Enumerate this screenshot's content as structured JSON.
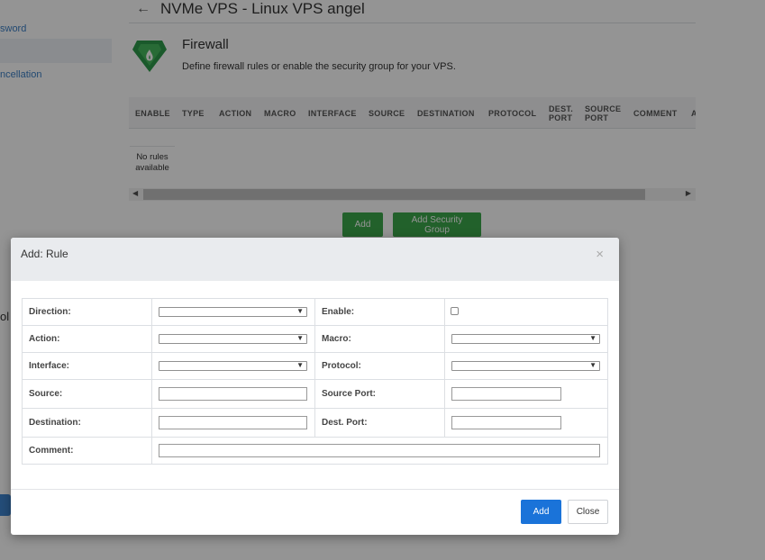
{
  "sidebar": {
    "items": [
      {
        "label": "sword"
      },
      {
        "label": "ncellation"
      }
    ],
    "partial_heading": "ol"
  },
  "header": {
    "back_icon": "arrow-left-icon",
    "title": "NVMe VPS - Linux VPS angel"
  },
  "firewall": {
    "icon": "firewall-shield-icon",
    "title": "Firewall",
    "description": "Define firewall rules or enable the security group for your VPS.",
    "columns": [
      "ENABLE",
      "TYPE",
      "ACTION",
      "MACRO",
      "INTERFACE",
      "SOURCE",
      "DESTINATION",
      "PROTOCOL",
      "DEST.\nPORT",
      "SOURCE\nPORT",
      "COMMENT",
      "A"
    ],
    "empty_text": "No rules\navailable",
    "add_button": "Add",
    "add_security_group_button": "Add Security Group",
    "accent_color": "#3ba74a"
  },
  "modal": {
    "title": "Add: Rule",
    "close_glyph": "×",
    "fields": {
      "direction": {
        "label": "Direction:",
        "value": ""
      },
      "enable": {
        "label": "Enable:",
        "checked": false
      },
      "action": {
        "label": "Action:",
        "value": ""
      },
      "macro": {
        "label": "Macro:",
        "value": ""
      },
      "interface": {
        "label": "Interface:",
        "value": ""
      },
      "protocol": {
        "label": "Protocol:",
        "value": ""
      },
      "source": {
        "label": "Source:",
        "value": ""
      },
      "source_port": {
        "label": "Source Port:",
        "value": ""
      },
      "destination": {
        "label": "Destination:",
        "value": ""
      },
      "dest_port": {
        "label": "Dest. Port:",
        "value": ""
      },
      "comment": {
        "label": "Comment:",
        "value": ""
      }
    },
    "add_button": "Add",
    "close_button": "Close",
    "primary_color": "#1a73d9"
  }
}
